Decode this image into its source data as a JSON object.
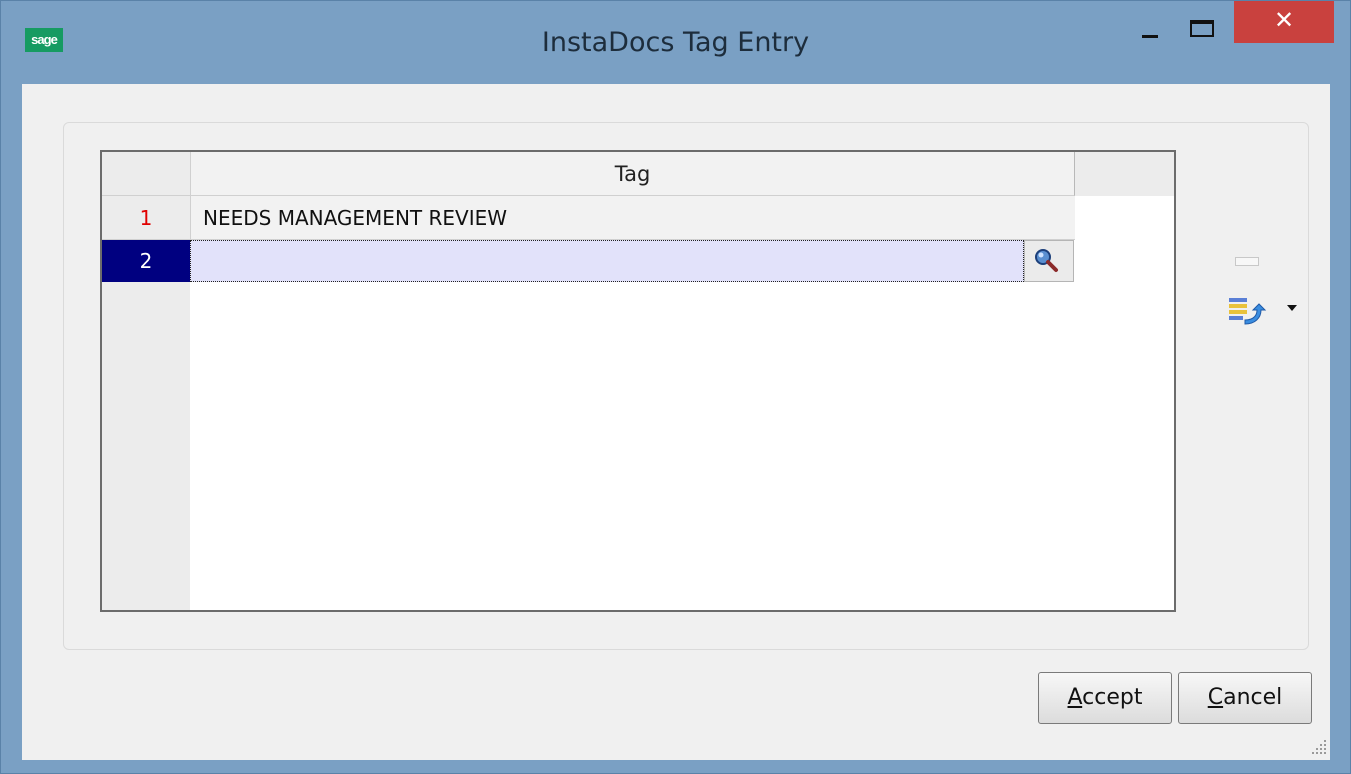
{
  "window": {
    "title": "InstaDocs Tag Entry",
    "app_icon_text": "sage",
    "close_glyph": "✕"
  },
  "grid": {
    "column_header": "Tag",
    "rows": [
      {
        "number": "1",
        "tag": "NEEDS MANAGEMENT REVIEW"
      },
      {
        "number": "2",
        "tag": ""
      }
    ]
  },
  "buttons": {
    "accept_label": "Accept",
    "accept_accel": "A",
    "accept_rest": "ccept",
    "cancel_label": "Cancel",
    "cancel_accel": "C",
    "cancel_rest": "ancel"
  },
  "icons": {
    "lookup": "magnifier-key-icon",
    "side1": "blank-button-icon",
    "side2": "list-swap-icon",
    "dropdown": "caret-down-icon"
  },
  "colors": {
    "titlebar": "#7aa0c4",
    "close": "#c9413e",
    "selected_row": "#000080",
    "row_number_active": "#e00000",
    "edit_cell": "#e2e2fa"
  }
}
